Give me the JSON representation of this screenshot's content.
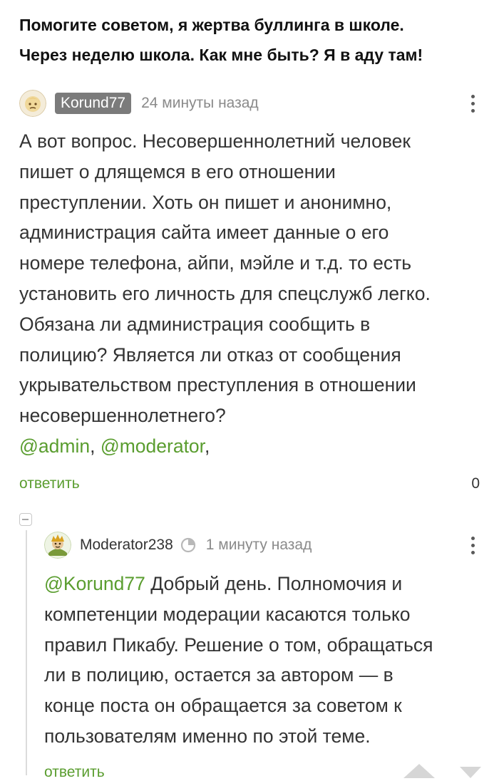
{
  "post": {
    "title_lines": [
      "Помогите советом, я жертва буллинга в школе.",
      "Через неделю школа. Как мне быть? Я в аду там!"
    ]
  },
  "comments": [
    {
      "username": "Korund77",
      "timestamp": "24 минуты назад",
      "avatar_icon": "user-avatar-icon",
      "body_lines": [
        "А вот вопрос. Несовершеннолетний человек",
        "пишет о длящемся в его отношении",
        "преступлении. Хоть он пишет и анонимно,",
        "администрация сайта имеет данные о его",
        "номере телефона, айпи, мэйле и т.д. то есть",
        "установить его личность для спецслужб легко.",
        "Обязана ли администрация сообщить в",
        "полицию? Является ли отказ от сообщения",
        "укрывательством преступления в отношении",
        "несовершеннолетнего?"
      ],
      "mentions": [
        "@admin",
        "@moderator"
      ],
      "mention_separator": ", ",
      "mention_trailing": ",",
      "reply_label": "ответить",
      "rating": "0"
    },
    {
      "username": "Moderator238",
      "timestamp": "1 минуту назад",
      "avatar_icon": "moderator-avatar-icon",
      "badge_icon": "moderator-badge-icon",
      "mention": "@Korund77",
      "first_line_rest": " Добрый день. Полномочия и",
      "body_lines": [
        "компетенции модерации касаются только",
        "правил Пикабу. Решение о том, обращаться",
        "ли в полицию, остается за автором — в",
        "конце поста он обращается за советом к",
        "пользователям именно по этой теме."
      ],
      "reply_label": "ответить"
    }
  ],
  "colors": {
    "accent_green": "#5a9d2f",
    "username_badge": "#7b7b7b",
    "muted_text": "#8a8a8a"
  }
}
